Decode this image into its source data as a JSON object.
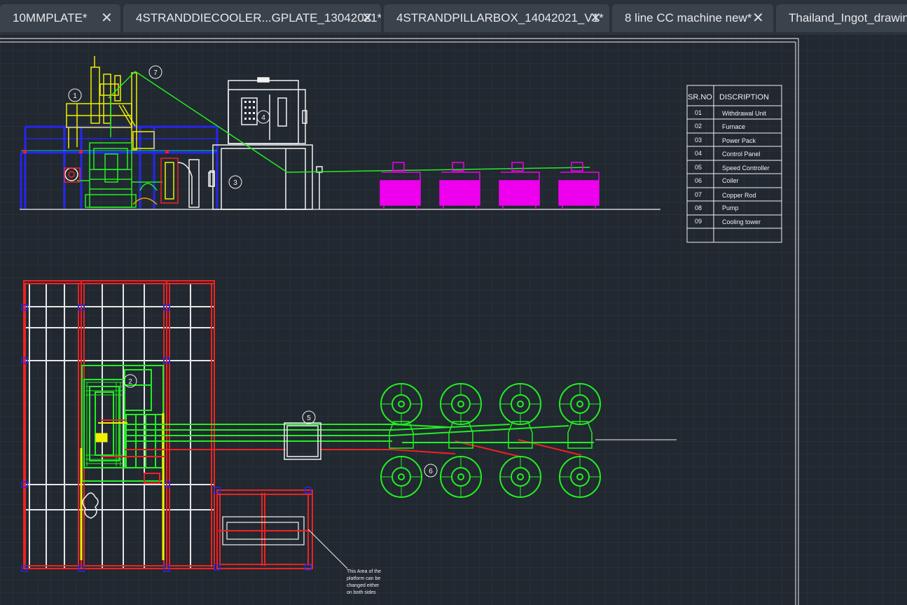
{
  "tabs": [
    {
      "label": "10MMPLATE*"
    },
    {
      "label": "4STRANDDIECOOLER...GPLATE_13042021*"
    },
    {
      "label": "4STRANDPILLARBOX_14042021_V1*"
    },
    {
      "label": "8 line CC machine new*"
    },
    {
      "label": "Thailand_Ingot_drawing"
    }
  ],
  "close_glyph": "✕",
  "table": {
    "header_no": "SR.NO",
    "header_desc": "DISCRIPTION",
    "rows": [
      {
        "no": "01",
        "desc": "Withdrawal Unit"
      },
      {
        "no": "02",
        "desc": "Furnace"
      },
      {
        "no": "03",
        "desc": "Power Pack"
      },
      {
        "no": "04",
        "desc": "Control Panel"
      },
      {
        "no": "05",
        "desc": "Speed Controller"
      },
      {
        "no": "06",
        "desc": "Coiler"
      },
      {
        "no": "07",
        "desc": "Copper Rod"
      },
      {
        "no": "08",
        "desc": "Pump"
      },
      {
        "no": "09",
        "desc": "Cooling tower"
      }
    ]
  },
  "balloons": {
    "b1": "1",
    "b2": "2",
    "b3": "3",
    "b4": "4",
    "b5": "5",
    "b6": "6",
    "b7": "7"
  },
  "note_lines": [
    "This Area of the",
    "platform can be",
    "changed either",
    "on both sides"
  ],
  "colors": {
    "background": "#212830",
    "grid": "#2c3540",
    "green": "#22ee22",
    "red": "#ee2222",
    "blue": "#2222ee",
    "yellow": "#f0f000",
    "magenta": "#ee00ee",
    "white": "#f2f2f2"
  }
}
